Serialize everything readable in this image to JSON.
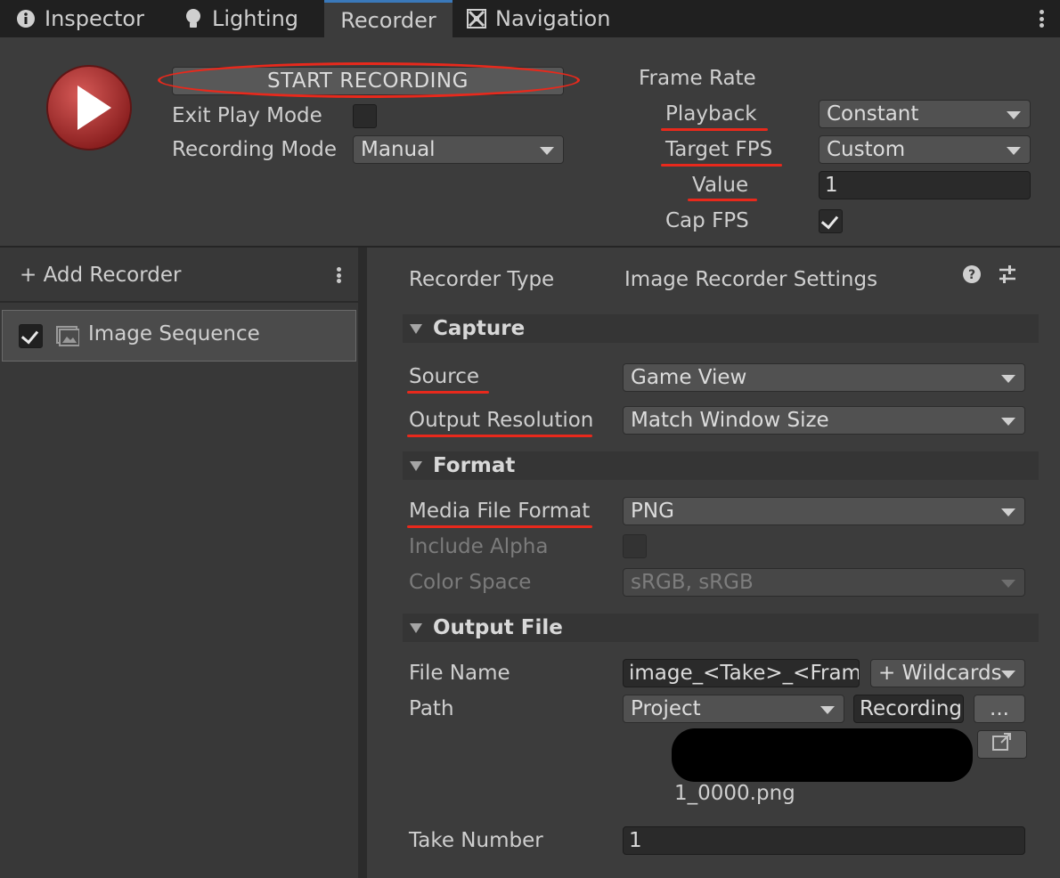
{
  "tabs": [
    {
      "label": "Inspector",
      "icon": "info-icon"
    },
    {
      "label": "Lighting",
      "icon": "bulb-icon"
    },
    {
      "label": "Recorder",
      "icon": ""
    },
    {
      "label": "Navigation",
      "icon": "navigation-icon"
    }
  ],
  "top": {
    "start_label": "START RECORDING",
    "exit_play_mode_label": "Exit Play Mode",
    "exit_play_mode_checked": false,
    "recording_mode_label": "Recording Mode",
    "recording_mode_value": "Manual",
    "frame_rate_title": "Frame Rate",
    "playback_label": "Playback",
    "playback_value": "Constant",
    "target_fps_label": "Target FPS",
    "target_fps_value": "Custom",
    "value_label": "Value",
    "value_value": "1",
    "cap_fps_label": "Cap FPS",
    "cap_fps_checked": true
  },
  "left": {
    "add_recorder_label": "+ Add Recorder",
    "recorders": [
      {
        "name": "Image Sequence",
        "enabled": true
      }
    ]
  },
  "settings": {
    "recorder_type_label": "Recorder Type",
    "recorder_type_value": "Image Recorder Settings",
    "capture_header": "Capture",
    "source_label": "Source",
    "source_value": "Game View",
    "output_resolution_label": "Output Resolution",
    "output_resolution_value": "Match Window Size",
    "format_header": "Format",
    "media_file_format_label": "Media File Format",
    "media_file_format_value": "PNG",
    "include_alpha_label": "Include Alpha",
    "color_space_label": "Color Space",
    "color_space_value": "sRGB, sRGB",
    "output_file_header": "Output File",
    "file_name_label": "File Name",
    "file_name_value": "image_<Take>_<Frame>",
    "wildcards_label": "+ Wildcards",
    "path_label": "Path",
    "path_root_value": "Project",
    "path_folder_value": "Recordings",
    "browse_label": "...",
    "output_preview": "1_0000.png",
    "take_number_label": "Take Number",
    "take_number_value": "1"
  },
  "colors": {
    "annotation_red": "#e8291c",
    "panel_bg": "#3c3c3c",
    "tab_active_border": "#3a79bb"
  }
}
